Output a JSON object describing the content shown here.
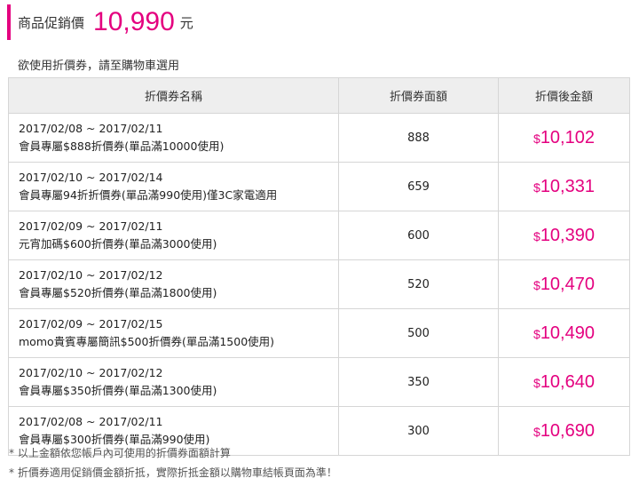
{
  "header": {
    "price_label": "商品促銷價",
    "price_value": "10,990",
    "price_unit": "元"
  },
  "instruction": "欲使用折價券，請至購物車選用",
  "table": {
    "columns": [
      "折價券名稱",
      "折價券面額",
      "折價後金額"
    ],
    "currency_symbol": "$",
    "rows": [
      {
        "date": "2017/02/08 ~ 2017/02/11",
        "name": "會員專屬$888折價券(單品滿10000使用)",
        "face": "888",
        "after": "10,102"
      },
      {
        "date": "2017/02/10 ~ 2017/02/14",
        "name": "會員專屬94折折價券(單品滿990使用)僅3C家電適用",
        "face": "659",
        "after": "10,331"
      },
      {
        "date": "2017/02/09 ~ 2017/02/11",
        "name": "元宵加碼$600折價券(單品滿3000使用)",
        "face": "600",
        "after": "10,390"
      },
      {
        "date": "2017/02/10 ~ 2017/02/12",
        "name": "會員專屬$520折價券(單品滿1800使用)",
        "face": "520",
        "after": "10,470"
      },
      {
        "date": "2017/02/09 ~ 2017/02/15",
        "name": "momo貴賓專屬簡訊$500折價券(單品滿1500使用)",
        "face": "500",
        "after": "10,490"
      },
      {
        "date": "2017/02/10 ~ 2017/02/12",
        "name": "會員專屬$350折價券(單品滿1300使用)",
        "face": "350",
        "after": "10,640"
      },
      {
        "date": "2017/02/08 ~ 2017/02/11",
        "name": "會員專屬$300折價券(單品滿990使用)",
        "face": "300",
        "after": "10,690"
      }
    ]
  },
  "notes": [
    "* 以上金額依您帳戶內可使用的折價券面額計算",
    "* 折價券適用促銷價金額折抵，實際折抵金額以購物車結帳頁面為準！"
  ],
  "colors": {
    "accent": "#e4007f",
    "header_bg": "#eeeeee",
    "border": "#d6d6d6"
  }
}
